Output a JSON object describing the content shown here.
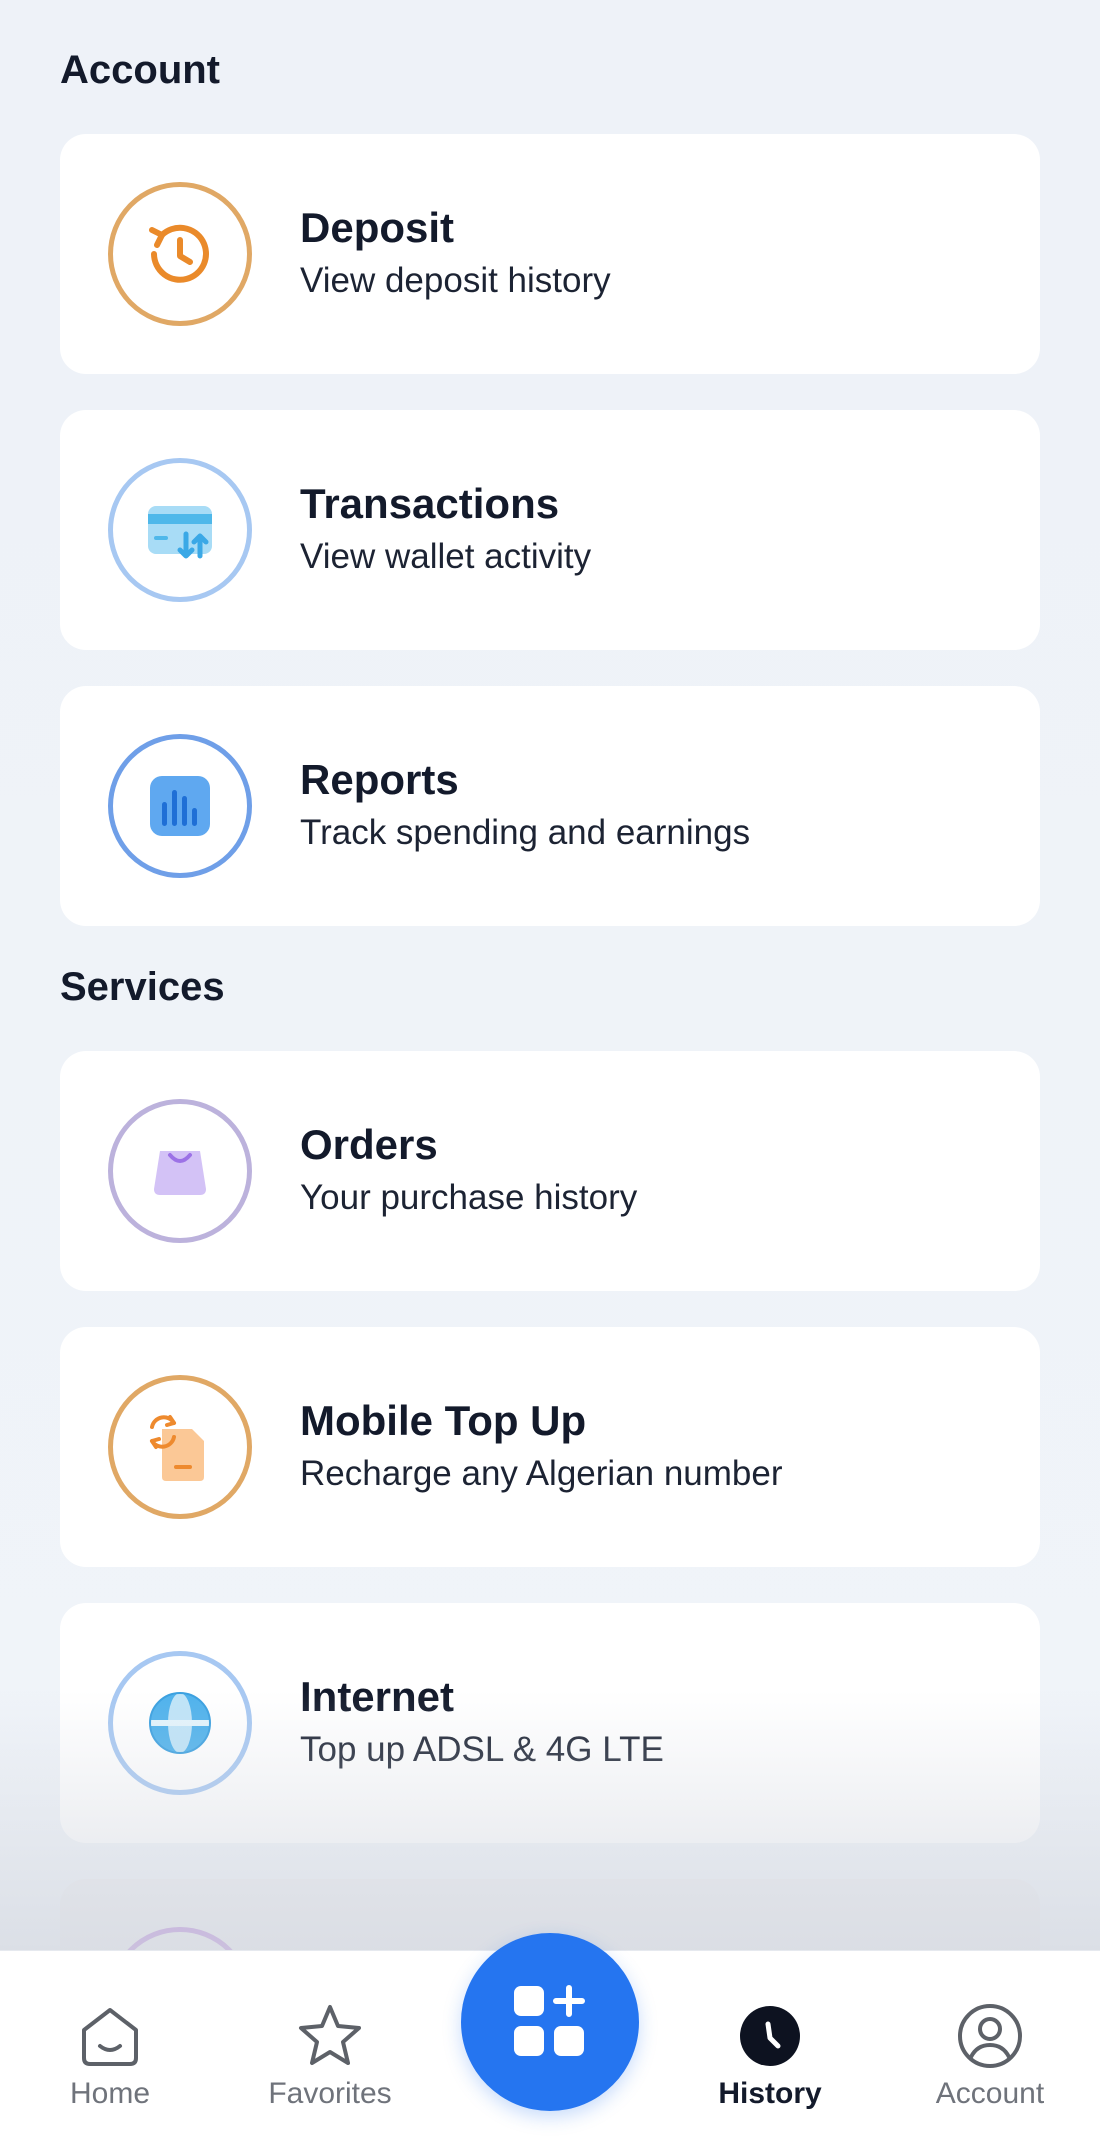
{
  "sections": {
    "account_title": "Account",
    "services_title": "Services"
  },
  "cards": {
    "deposit": {
      "title": "Deposit",
      "subtitle": "View deposit history",
      "icon": "history-clock-icon",
      "ring_color": "#e0a865"
    },
    "transactions": {
      "title": "Transactions",
      "subtitle": "View wallet activity",
      "icon": "wallet-transfer-icon",
      "ring_color": "#a7c8f2"
    },
    "reports": {
      "title": "Reports",
      "subtitle": "Track spending and earnings",
      "icon": "bar-chart-icon",
      "ring_color": "#6f9fe8"
    },
    "orders": {
      "title": "Orders",
      "subtitle": "Your purchase history",
      "icon": "shopping-bag-icon",
      "ring_color": "#bcb2dc"
    },
    "mobile_top_up": {
      "title": "Mobile Top Up",
      "subtitle": "Recharge any Algerian number",
      "icon": "sim-refresh-icon",
      "ring_color": "#e0a865"
    },
    "internet": {
      "title": "Internet",
      "subtitle": "Top up ADSL & 4G LTE",
      "icon": "globe-icon",
      "ring_color": "#a7c8f2"
    }
  },
  "nav": {
    "home": "Home",
    "favorites": "Favorites",
    "history": "History",
    "account": "Account",
    "active": "history",
    "fab_icon": "add-apps-icon",
    "fab_color": "#2575f0"
  }
}
